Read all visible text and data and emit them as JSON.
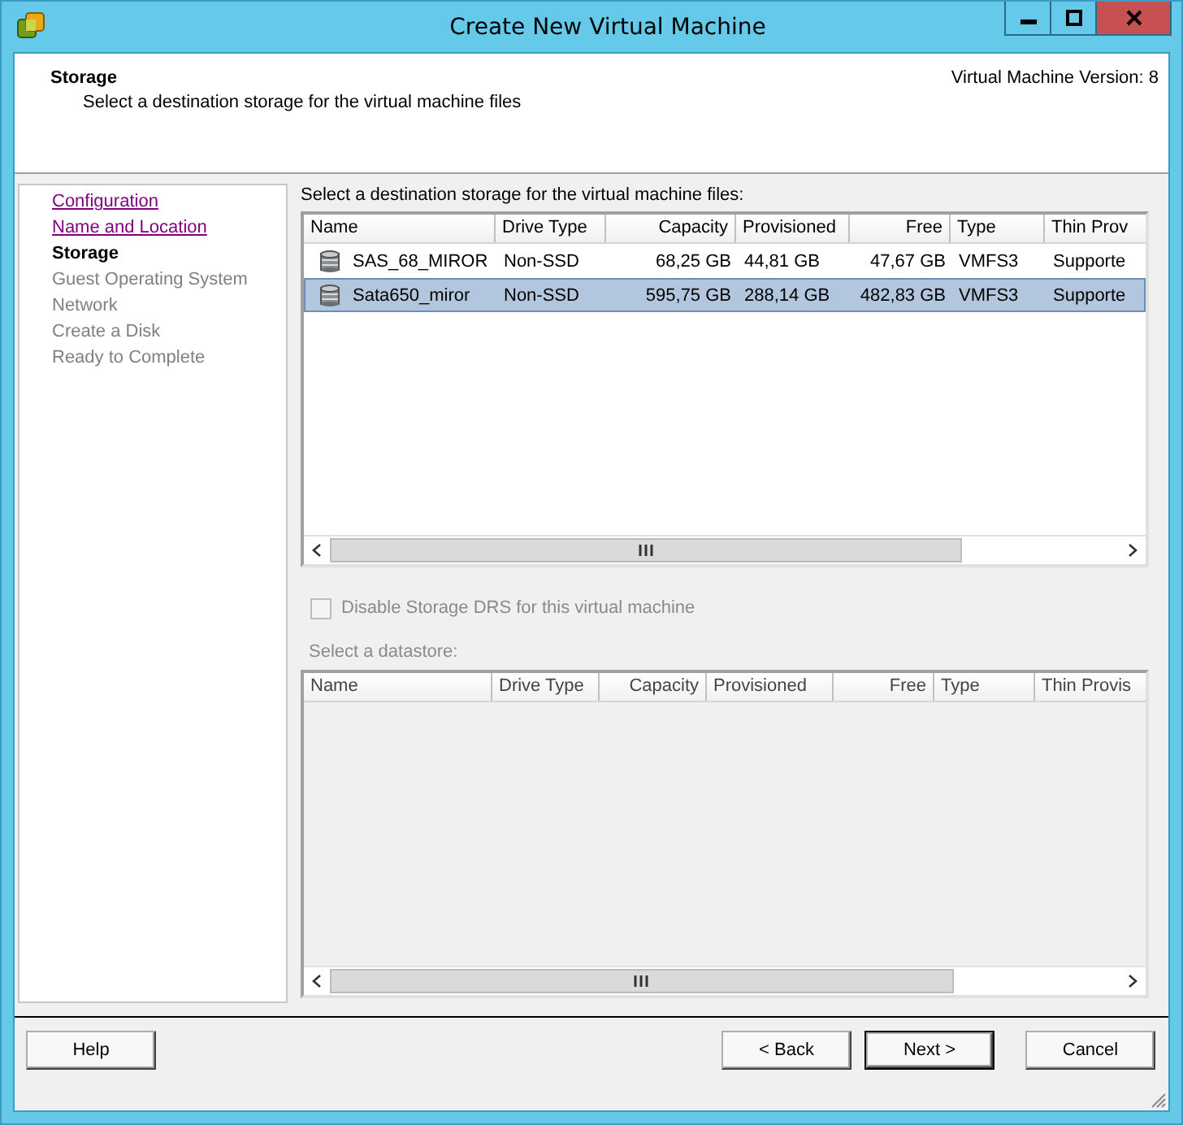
{
  "window": {
    "title": "Create New Virtual Machine"
  },
  "header": {
    "title": "Storage",
    "subtitle": "Select a destination storage for the virtual machine files",
    "version": "Virtual Machine Version: 8"
  },
  "steps": [
    {
      "label": "Configuration",
      "kind": "done"
    },
    {
      "label": "Name and Location",
      "kind": "done"
    },
    {
      "label": "Storage",
      "kind": "current"
    },
    {
      "label": "Guest Operating System",
      "kind": "pending"
    },
    {
      "label": "Network",
      "kind": "pending"
    },
    {
      "label": "Create a Disk",
      "kind": "pending"
    },
    {
      "label": "Ready to Complete",
      "kind": "pending"
    }
  ],
  "storage_prompt": "Select a destination storage for the virtual machine files:",
  "storage_table": {
    "columns": [
      "Name",
      "Drive Type",
      "Capacity",
      "Provisioned",
      "Free",
      "Type",
      "Thin Prov"
    ],
    "rows": [
      {
        "selected": false,
        "cells": [
          "SAS_68_MIROR",
          "Non-SSD",
          "68,25 GB",
          "44,81 GB",
          "47,67 GB",
          "VMFS3",
          "Supporte"
        ]
      },
      {
        "selected": true,
        "cells": [
          "Sata650_miror",
          "Non-SSD",
          "595,75 GB",
          "288,14 GB",
          "482,83 GB",
          "VMFS3",
          "Supporte"
        ]
      }
    ]
  },
  "drs_checkbox": {
    "label": "Disable Storage DRS for this virtual machine",
    "checked": false,
    "disabled": true
  },
  "datastore_prompt": "Select a datastore:",
  "datastore_table": {
    "columns": [
      "Name",
      "Drive Type",
      "Capacity",
      "Provisioned",
      "Free",
      "Type",
      "Thin Provis"
    ]
  },
  "buttons": [
    {
      "label": "Help",
      "default": false
    },
    {
      "label": "< Back",
      "default": false
    },
    {
      "label": "Next >",
      "default": true
    },
    {
      "label": "Cancel",
      "default": false
    }
  ]
}
